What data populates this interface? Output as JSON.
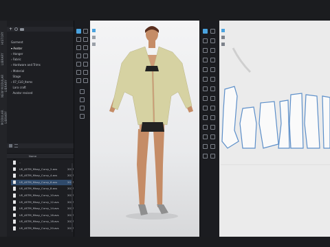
{
  "library": {
    "title": "Library",
    "vertical_tabs": [
      "MODULAR LIBRARY",
      "NEW MODULAR LIBRARY",
      "LIBRARY",
      "HISTORY"
    ],
    "tree": [
      {
        "label": "Garment",
        "expanded": false
      },
      {
        "label": "Avatar",
        "expanded": true,
        "selected": true
      },
      {
        "label": "Hanger",
        "expanded": false
      },
      {
        "label": "Fabric",
        "expanded": false
      },
      {
        "label": "Hardware and Trims",
        "expanded": false
      },
      {
        "label": "Material",
        "expanded": false
      },
      {
        "label": "Stage",
        "expanded": false
      },
      {
        "label": "07_CLO_Items",
        "expanded": false
      },
      {
        "label": "Lara craft",
        "expanded": false
      },
      {
        "label": "Avatar revised",
        "expanded": false
      }
    ],
    "file_column": "Name",
    "files": [
      {
        "name": "..",
        "year": ""
      },
      {
        "name": "US_ASTM_Missy_Curvy_2.avs",
        "year": "2023"
      },
      {
        "name": "US_ASTM_Missy_Curvy_4.avs",
        "year": "2023"
      },
      {
        "name": "US_ASTM_Missy_Curvy_6.avs",
        "year": "2023",
        "selected": true
      },
      {
        "name": "US_ASTM_Missy_Curvy_8.avs",
        "year": "2023"
      },
      {
        "name": "US_ASTM_Missy_Curvy_10.avs",
        "year": "2023"
      },
      {
        "name": "US_ASTM_Missy_Curvy_12.avs",
        "year": "2023"
      },
      {
        "name": "US_ASTM_Missy_Curvy_14.avs",
        "year": "2023"
      },
      {
        "name": "US_ASTM_Missy_Curvy_16.avs",
        "year": "2023"
      },
      {
        "name": "US_ASTM_Missy_Curvy_18.avs",
        "year": "2023"
      },
      {
        "name": "US_ASTM_Missy_Curvy_20.avs",
        "year": "2023"
      }
    ]
  },
  "window": {
    "view3d_title": "[st draft blazer.zprj]",
    "view2d_title": "2D Pattern Window"
  },
  "colors": {
    "panel_bg": "#1d1e22",
    "selection": "#2f4a6b",
    "garment": "#d6d2a2",
    "pattern_outline": "#5b8ec9",
    "accent_icon": "#4aa3df"
  }
}
